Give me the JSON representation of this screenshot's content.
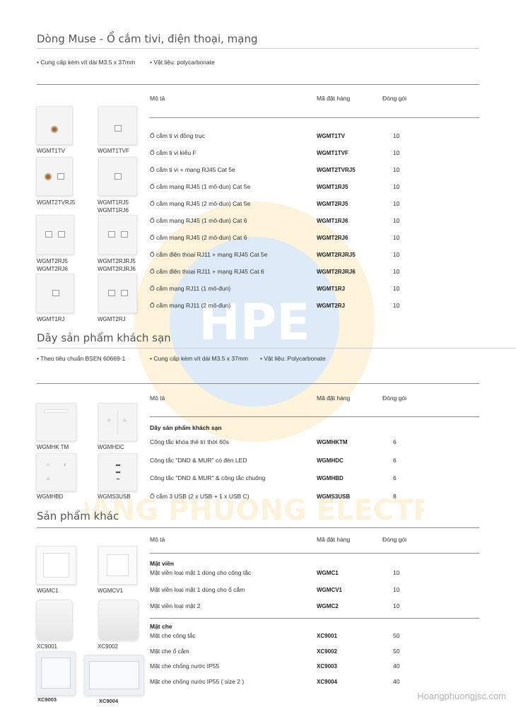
{
  "section1": {
    "title": "Dòng Muse - Ổ cắm tivi, điện thoại, mạng",
    "notes": [
      "• Cung cấp kèm vít dài M3.5 x 37mm",
      "• Vật liệu: polycarbonate"
    ],
    "headers": {
      "desc": "Mô tả",
      "code": "Mã đặt hàng",
      "pack": "Đóng gói"
    },
    "rows": [
      {
        "desc": "Ổ cắm ti vi đồng trục",
        "code": "WGMT1TV",
        "pack": "10"
      },
      {
        "desc": "Ổ cắm ti vi kiểu F",
        "code": "WGMT1TVF",
        "pack": "10"
      },
      {
        "desc": "Ổ cắm ti vi + mạng RJ45 Cat 5e",
        "code": "WGMT2TVRJ5",
        "pack": "10"
      },
      {
        "desc": "Ổ cắm mạng RJ45 (1 mô-đun) Cat 5e",
        "code": "WGMT1RJ5",
        "pack": "10"
      },
      {
        "desc": "Ổ cắm mạng RJ45 (2 mô-đun) Cat 5e",
        "code": "WGMT2RJ5",
        "pack": "10"
      },
      {
        "desc": "Ổ cắm mạng RJ45 (1 mô-đun) Cat 6",
        "code": "WGMT1RJ6",
        "pack": "10"
      },
      {
        "desc": "Ổ cắm mạng RJ45 (2 mô-đun) Cat 6",
        "code": "WGMT2RJ6",
        "pack": "10"
      },
      {
        "desc": "Ổ cắm điện thoại RJ11 + mạng RJ45 Cat 5e",
        "code": "WGMT2RJRJ5",
        "pack": "10"
      },
      {
        "desc": "Ổ cắm điện thoại RJ11 + mạng RJ45 Cat 6",
        "code": "WGMT2RJRJ6",
        "pack": "10"
      },
      {
        "desc": "Ổ cắm mạng RJ11 (1 mô-đun)",
        "code": "WGMT1RJ",
        "pack": "10"
      },
      {
        "desc": "Ổ cắm mạng RJ11 (2 mô-đun)",
        "code": "WGMT2RJ",
        "pack": "10"
      }
    ],
    "captions": [
      "WGMT1TV",
      "WGMT1TVF",
      "WGMT2TVRJ5",
      "WGMT1RJ5",
      "WGMT1RJ6",
      "WGMT2RJ5",
      "WGMT2RJ6",
      "WGMT2RJRJ5",
      "WGMT2RJRJ6",
      "WGMT1RJ",
      "WGMT2RJ"
    ]
  },
  "section2": {
    "title": "Dãy sản phẩm khách sạn",
    "notes": [
      "• Theo tiêu chuẩn BSEN 60669-1",
      "• Cung cấp kèm vít dài  M3.5 x 37mm",
      "• Vật liệu: Polycarbonate"
    ],
    "headers": {
      "desc": "Mô tả",
      "code": "Mã đặt hàng",
      "pack": "Đóng gói"
    },
    "group": "Dãy sản phẩm khách sạn",
    "rows": [
      {
        "desc": "Công tắc khóa thẻ trì thời 60s",
        "code": "WGMHKTM",
        "pack": "6"
      },
      {
        "desc": "Công tắc \"DND & MUR\" có đèn LED",
        "code": "WGMHDC",
        "pack": "6"
      },
      {
        "desc": "Công tắc \"DND & MUR\" & công tắc chuông",
        "code": "WGMHBD",
        "pack": "6"
      },
      {
        "desc": "Ổ cắm 3 USB (2 x USB + 1 x USB C)",
        "code": "WGMS3USB",
        "pack": "8"
      }
    ],
    "captions": [
      "WGMHK TM",
      "WGMHDC",
      "WGMHBD",
      "WGMS3USB"
    ]
  },
  "section3": {
    "title": "Sản phẩm khác",
    "headers": {
      "desc": "Mô tả",
      "code": "Mã đặt hàng",
      "pack": "Đóng gói"
    },
    "group1": "Mặt viền",
    "rows1": [
      {
        "desc": "Mặt viền loại mặt 1 dùng cho công tắc",
        "code": "WGMC1",
        "pack": "10"
      },
      {
        "desc": " Mặt viền loại mặt 1 dùng cho ổ cắm",
        "code": "WGMCV1",
        "pack": "10"
      },
      {
        "desc": "Mặt viền loại mặt 2",
        "code": "WGMC2",
        "pack": "10"
      }
    ],
    "group2": "Mặt che",
    "rows2": [
      {
        "desc": "Mặt che công tắc",
        "code": "XC9001",
        "pack": "50"
      },
      {
        "desc": "Mặt che ổ cắm",
        "code": "XC9002",
        "pack": "50"
      },
      {
        "desc": "Mặt che chống nước IP55",
        "code": "XC9003",
        "pack": "40"
      },
      {
        "desc": "Mặt che chống nước IP55 ( size 2 )",
        "code": "XC9004",
        "pack": "40"
      }
    ],
    "captions": [
      "WGMC1",
      "WGMCV1",
      "XC9001",
      "XC9002",
      "XC9003",
      "XC9004"
    ]
  },
  "watermark": {
    "text": "HOANG PHUONG ELECTRIC",
    "logo": "HPE"
  },
  "footer": "Hoangphuongjsc.com"
}
